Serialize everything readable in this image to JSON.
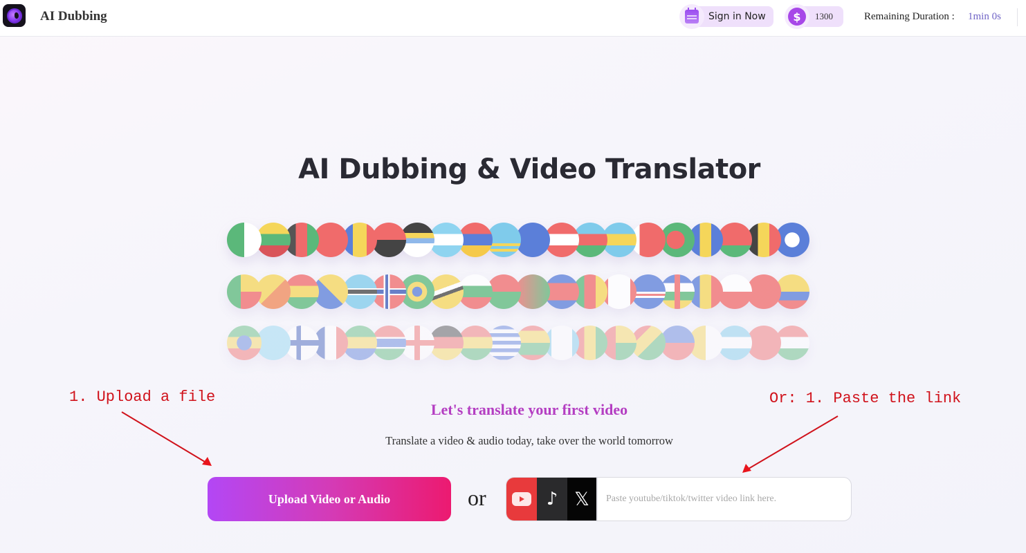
{
  "header": {
    "app_title": "AI Dubbing",
    "logo_icon": "globe-logo-icon",
    "sign_in_label": "Sign in Now",
    "sign_in_icon": "calendar-icon",
    "coins_icon": "dollar-icon",
    "coins_symbol": "$",
    "coins_value": "1300",
    "remaining_duration_label": "Remaining Duration :",
    "remaining_duration_value": "1min 0s"
  },
  "main": {
    "title": "AI Dubbing & Video Translator",
    "flag_rows": [
      [
        "Algeria",
        "Lithuania",
        "Afghanistan",
        "Albania",
        "Andorra",
        "Angola",
        "Antigua and Barbuda",
        "Argentina",
        "Armenia",
        "Aruba",
        "Australia",
        "Austria",
        "Azerbaijan",
        "Bahamas",
        "Bahrain",
        "Bangladesh",
        "Barbados",
        "Belarus",
        "Belgium",
        "Belize"
      ],
      [
        "Benin",
        "Bhutan",
        "Bolivia",
        "Bosnia and Herzegovina",
        "Botswana",
        "Norway",
        "Brazil",
        "Brunei",
        "Bulgaria",
        "Burkina Faso",
        "Burundi",
        "Cambodia",
        "Cameroon",
        "Canada",
        "Cape Verde",
        "Central African Republic",
        "Chad",
        "Chile",
        "China",
        "Colombia"
      ],
      [
        "Ethiopia",
        "Fiji",
        "Finland",
        "France",
        "Gabon",
        "Gambia",
        "Georgia",
        "Germany",
        "Ghana",
        "Greece",
        "Grenada",
        "Guatemala",
        "Guinea",
        "Guinea-Bissau",
        "Guyana",
        "Haiti",
        "Vatican",
        "Honduras",
        "Hong Kong",
        "Hungary"
      ]
    ],
    "subtitle": "Let's translate your first video",
    "tagline": "Translate a video & audio today, take over the world tomorrow",
    "upload_button_label": "Upload Video or Audio",
    "or_label": "or",
    "link_sources": [
      {
        "name": "youtube",
        "icon": "youtube-icon"
      },
      {
        "name": "tiktok",
        "icon": "tiktok-icon",
        "glyph": "♪"
      },
      {
        "name": "twitter",
        "icon": "x-icon",
        "glyph": "𝕏"
      }
    ],
    "link_input": {
      "value": "",
      "placeholder": "Paste youtube/tiktok/twitter video link here."
    }
  },
  "annotations": {
    "left": "1. Upload a file",
    "right": "Or: 1. Paste the link",
    "color": "#d0121b"
  },
  "colors": {
    "accent_purple": "#b347f5",
    "accent_pink": "#ec1a70",
    "subtitle": "#b43ec2",
    "duration": "#6f63c6"
  }
}
